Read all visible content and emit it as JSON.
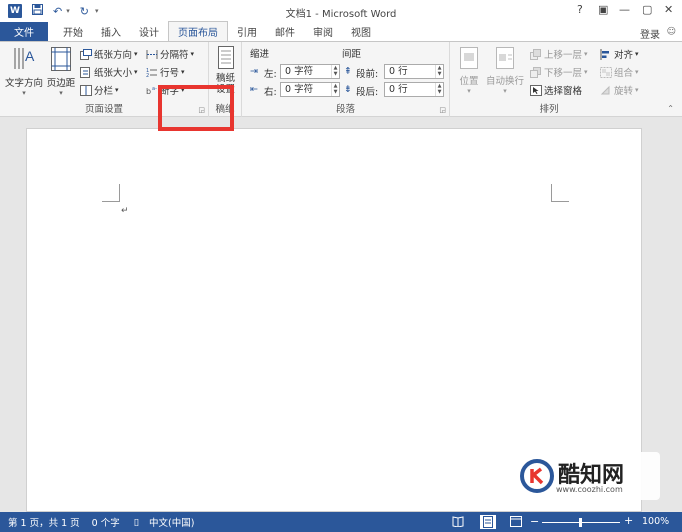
{
  "titlebar": {
    "title": "文档1 - Microsoft Word",
    "word_logo": "W",
    "controls": [
      "?",
      "▣",
      "—",
      "▢",
      "✕"
    ]
  },
  "tabs": {
    "file": "文件",
    "items": [
      "开始",
      "插入",
      "设计",
      "页面布局",
      "引用",
      "邮件",
      "审阅",
      "视图"
    ],
    "active": "页面布局",
    "login": "登录"
  },
  "ribbon": {
    "page_setup": {
      "label": "页面设置",
      "text_direction": "文字方向",
      "margins": "页边距",
      "orientation": "纸张方向",
      "size": "纸张大小",
      "columns": "分栏",
      "breaks": "分隔符",
      "line_numbers": "行号",
      "hyphenation": "断字"
    },
    "draft": {
      "label": "稿纸",
      "button": "稿纸设置"
    },
    "paragraph": {
      "label": "段落",
      "indent_label": "缩进",
      "spacing_label": "间距",
      "left_label": "左:",
      "right_label": "右:",
      "before_label": "段前:",
      "after_label": "段后:",
      "left_value": "0 字符",
      "right_value": "0 字符",
      "before_value": "0 行",
      "after_value": "0 行"
    },
    "arrange": {
      "label": "排列",
      "position": "位置",
      "wrap_text": "自动换行",
      "bring_forward": "上移一层",
      "send_backward": "下移一层",
      "selection_pane": "选择窗格",
      "align": "对齐",
      "group": "组合",
      "rotate": "旋转"
    }
  },
  "document": {
    "paragraph_mark": "↵"
  },
  "statusbar": {
    "page": "第 1 页，共 1 页",
    "words": "0 个字",
    "language": "中文(中国)",
    "zoom": "100%"
  },
  "watermark": {
    "name": "酷知网",
    "url": "www.coozhi.com"
  },
  "colors": {
    "accent": "#2b579a",
    "highlight": "#e8352f"
  }
}
